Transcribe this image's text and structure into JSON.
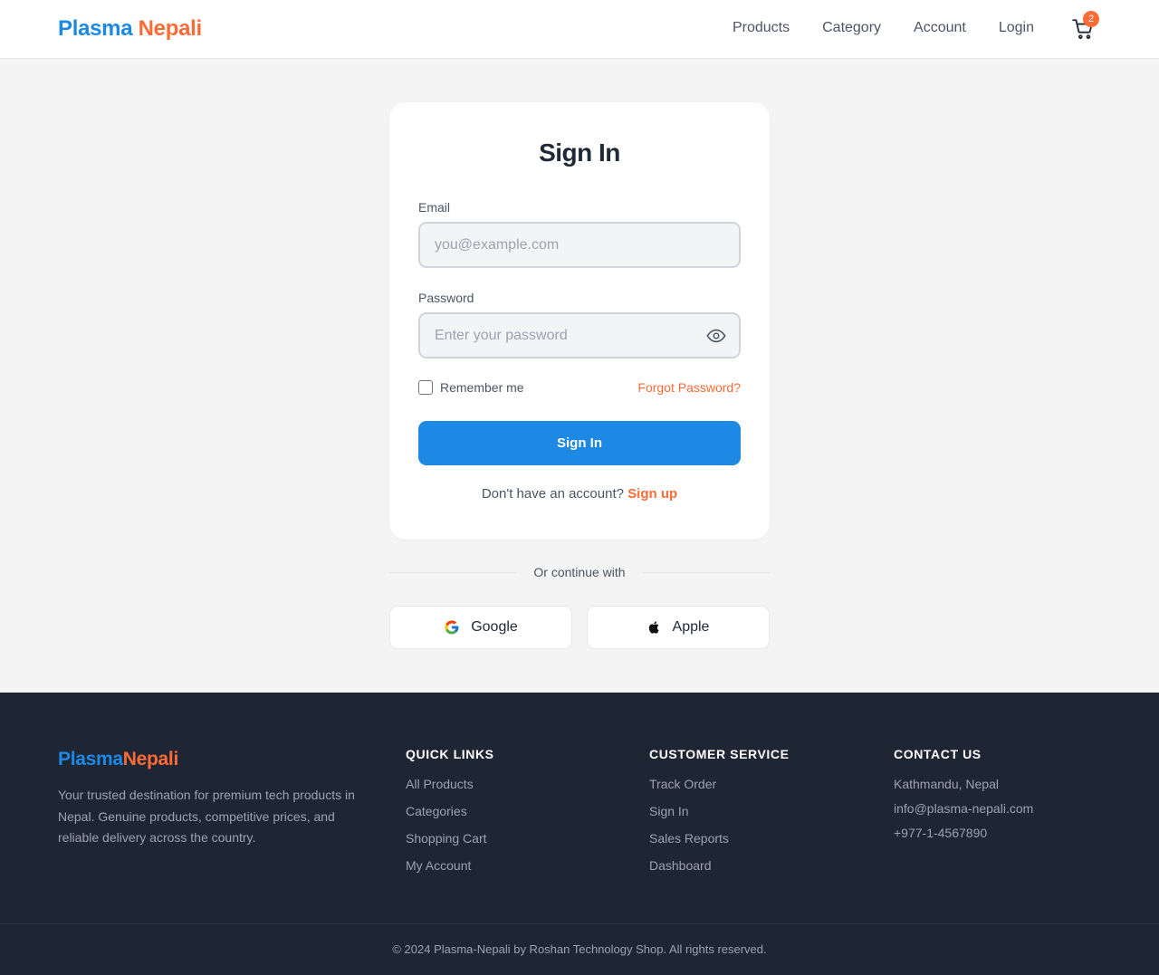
{
  "header": {
    "logo_part1": "Plasma",
    "logo_part2": "Nepali",
    "nav": [
      {
        "label": "Products"
      },
      {
        "label": "Category"
      },
      {
        "label": "Account"
      },
      {
        "label": "Login"
      }
    ],
    "cart_count": "2",
    "cart_icon": "shopping-cart-icon"
  },
  "signin": {
    "title": "Sign In",
    "email_label": "Email",
    "email_value": "",
    "email_placeholder": "you@example.com",
    "password_label": "Password",
    "password_value": "",
    "password_placeholder": "Enter your password",
    "password_toggle_icon": "eye-icon",
    "remember_label": "Remember me",
    "remember_checked": false,
    "forgot_label": "Forgot Password?",
    "submit_label": "Sign In",
    "no_account_text": "Don't have an account?",
    "signup_label": "Sign up"
  },
  "social": {
    "divider_text": "Or continue with",
    "google_label": "Google",
    "google_icon": "google-icon",
    "apple_label": "Apple",
    "apple_icon": "apple-icon"
  },
  "footer": {
    "logo_part1": "Plasma",
    "logo_part2": "Nepali",
    "description": "Your trusted destination for premium tech products in Nepal. Genuine products, competitive prices, and reliable delivery across the country.",
    "quick_links": {
      "heading": "QUICK LINKS",
      "items": [
        "All Products",
        "Categories",
        "Shopping Cart",
        "My Account"
      ]
    },
    "customer_service": {
      "heading": "CUSTOMER SERVICE",
      "items": [
        "Track Order",
        "Sign In",
        "Sales Reports",
        "Dashboard"
      ]
    },
    "contact": {
      "heading": "CONTACT US",
      "items": [
        "Kathmandu, Nepal",
        "info@plasma-nepali.com",
        "+977-1-4567890"
      ]
    },
    "copyright": "© 2024 Plasma-Nepali by Roshan Technology Shop. All rights reserved."
  },
  "colors": {
    "primary": "#1e88e5",
    "accent": "#ff6b35",
    "footer_bg": "#1e2533",
    "page_bg": "#f4f4f4"
  }
}
